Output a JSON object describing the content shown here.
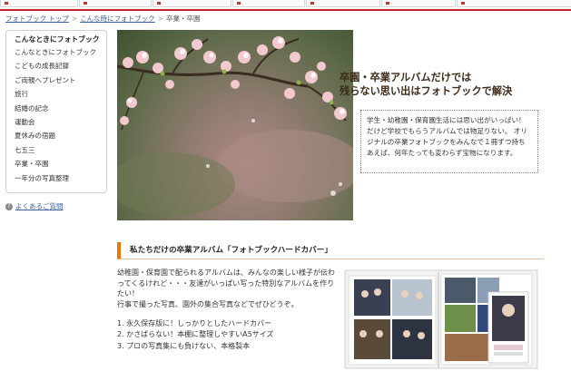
{
  "breadcrumb": {
    "items": [
      {
        "label": "フォトブック トップ",
        "link": true
      },
      {
        "label": "こんな時にフォトブック",
        "link": true
      },
      {
        "label": "卒業・卒園",
        "link": false
      }
    ]
  },
  "sidebar": {
    "title": "こんなときにフォトブック",
    "items": [
      "こんなときにフォトブック",
      "こどもの成長記録",
      "ご両親へプレゼント",
      "旅行",
      "結婚の記念",
      "運動会",
      "夏休みの宿題",
      "七五三",
      "卒業・卒園",
      "一年分の写真整理"
    ]
  },
  "help": {
    "label": "よくあるご質問"
  },
  "hero": {
    "headline_line1": "卒園・卒業アルバムだけでは",
    "headline_line2": "残らない思い出はフォトブックで解決",
    "intro": "学生・幼稚園・保育園生活には思い出がいっぱい！ だけど学校でもらうアルバムでは物足りない。 オリジナルの卒業フォトブックをみんなで１冊ずつ持ちあえば、何年たっても変わらず宝物になります。"
  },
  "section": {
    "title": "私たちだけの卒業アルバム「フォトブックハードカバー」",
    "description": "幼稚園・保育園で配られるアルバムは、みんなの楽しい様子が伝わってくるけれど・・・友達がいっぱい写った特別なアルバムを作りたい！\n行事で撮った写真、園外の集合写真などでぜひどうぞ。",
    "features": [
      "1.  永久保存版に！しっかりとしたハードカバー",
      "2.  かさばらない！本棚に整理しやすいA5サイズ",
      "3.  プロの写真集にも負けない、本格製本"
    ]
  },
  "colors": {
    "brand_red": "#c41e2a",
    "accent_orange": "#ee7700",
    "link_blue": "#3a5fa0"
  }
}
